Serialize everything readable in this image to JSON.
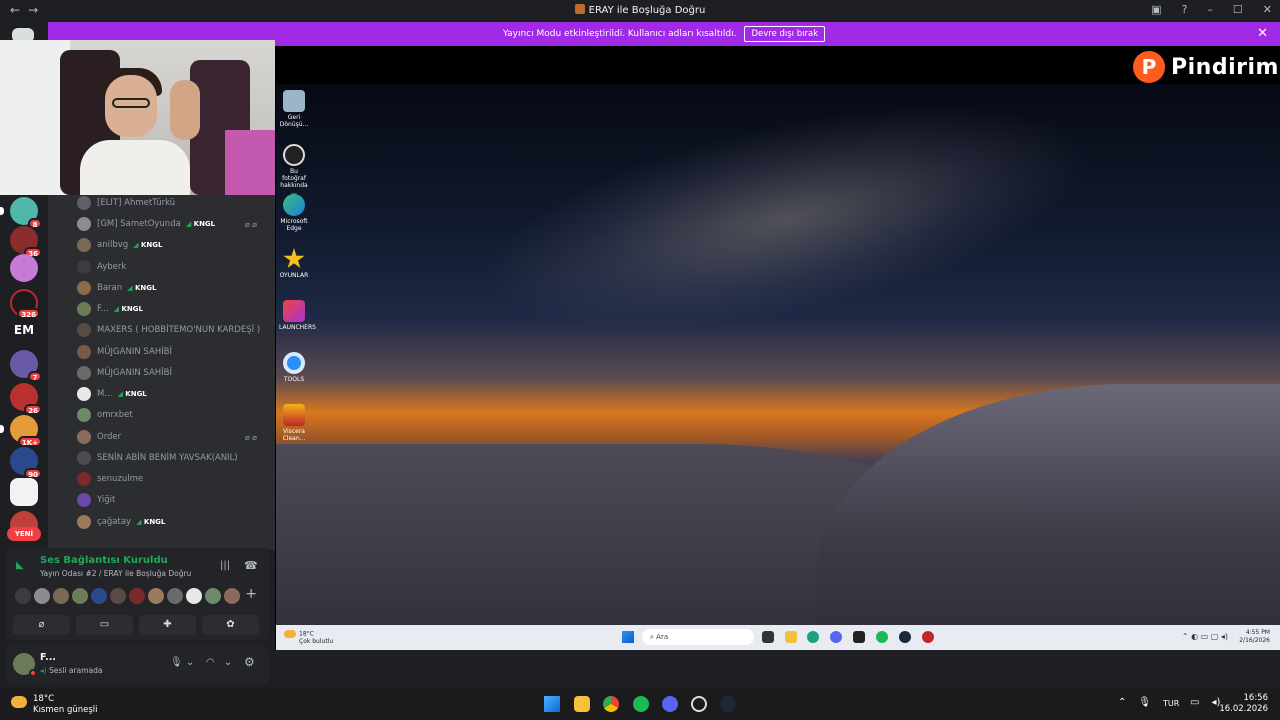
{
  "window": {
    "title": "ERAY ile Boşluğa Doğru"
  },
  "banner": {
    "message": "Yayıncı Modu etkinleştirildi. Kullanıcı adları kısaltıldı.",
    "button": "Devre dışı bırak"
  },
  "servers": {
    "badges": [
      "8",
      "36",
      "326",
      "7",
      "26",
      "1K+",
      "90"
    ],
    "em_label": "EM",
    "new_label": "YENİ"
  },
  "members": [
    {
      "name": "[ELIT] AhmetTürkü",
      "tag": ""
    },
    {
      "name": "[GM] SametOyunda",
      "tag": "KNGL"
    },
    {
      "name": "anilbvg",
      "tag": "KNGL"
    },
    {
      "name": "Ayberk",
      "tag": ""
    },
    {
      "name": "Baran",
      "tag": "KNGL"
    },
    {
      "name": "F...",
      "tag": "KNGL"
    },
    {
      "name": "MAXERS ( HOBBİTEMO'NUN KARDEŞİ )",
      "tag": ""
    },
    {
      "name": "MÜJGANIN SAHİBİ",
      "tag": ""
    },
    {
      "name": "MÜJGANIN SAHİBİ",
      "tag": ""
    },
    {
      "name": "M...",
      "tag": "KNGL"
    },
    {
      "name": "omrxbet",
      "tag": ""
    },
    {
      "name": "Order",
      "tag": ""
    },
    {
      "name": "SENİN ABİN BENİM YAVSAK(ANIL)",
      "tag": ""
    },
    {
      "name": "senuzulme",
      "tag": ""
    },
    {
      "name": "Yiğit",
      "tag": ""
    },
    {
      "name": "çağatay",
      "tag": "KNGL"
    }
  ],
  "voice": {
    "status": "Ses Bağlantısı Kuruldu",
    "channel": "Yayın Odası #2 / ERAY ile Boşluğa Doğru"
  },
  "user": {
    "name": "F...",
    "status": "Sesli aramada"
  },
  "stream": {
    "brand": "Pindirim",
    "brand_letter": "P",
    "desktop_icons": [
      "Geri Dönüşü...",
      "Bu fotoğraf hakkında ...",
      "Microsoft Edge",
      "OYUNLAR",
      "LAUNCHERS",
      "TOOLS",
      "Viscera Clean..."
    ],
    "taskbar": {
      "temp": "18°C",
      "weather": "Çok bulutlu",
      "search": "Ara",
      "time": "4:55 PM",
      "date": "2/16/2026"
    }
  },
  "host_taskbar": {
    "temp": "18°C",
    "weather": "Kısmen güneşli",
    "lang": "TUR",
    "time": "16:56",
    "date": "16.02.2026"
  },
  "colors": {
    "banner": "#a12ae6",
    "badge": "#f23f43",
    "connected": "#23a55a",
    "brand": "#ff5a1f"
  }
}
